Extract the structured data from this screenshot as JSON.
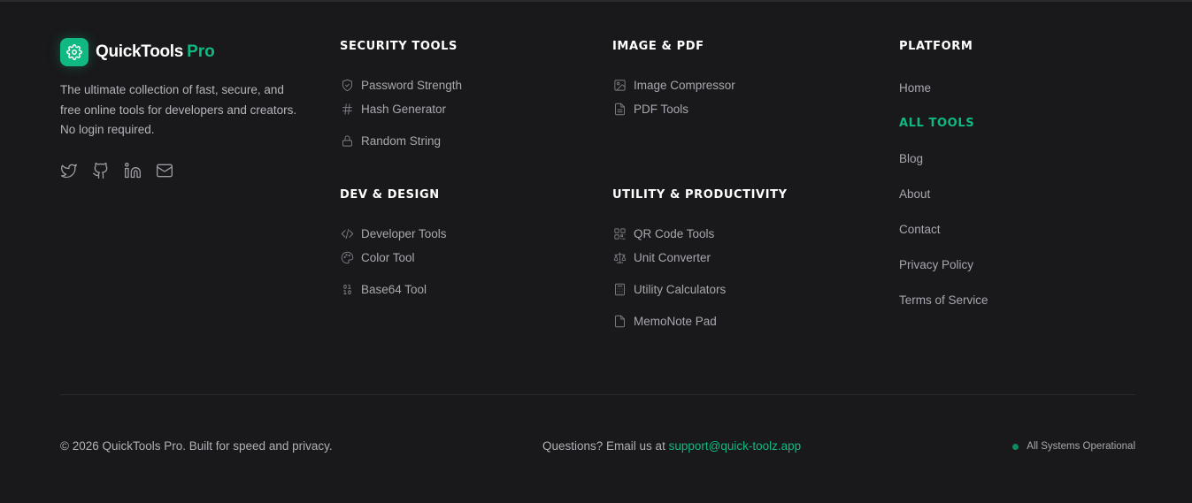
{
  "colors": {
    "accent": "#10b981",
    "background": "#19181a"
  },
  "brand": {
    "name": "QuickTools",
    "accent": "Pro",
    "logo_icon": "gear-icon",
    "description": "The ultimate collection of fast, secure, and free online tools for developers and creators. No login required.",
    "socials": [
      {
        "icon": "twitter-icon"
      },
      {
        "icon": "github-icon"
      },
      {
        "icon": "linkedin-icon"
      },
      {
        "icon": "mail-icon"
      }
    ]
  },
  "security": {
    "heading": "SECURITY TOOLS",
    "items": [
      {
        "label": "Password Strength",
        "icon": "shield-icon"
      },
      {
        "label": "Hash Generator",
        "icon": "hash-icon"
      },
      {
        "label": "Random String",
        "icon": "lock-icon"
      }
    ]
  },
  "dev": {
    "heading": "DEV & DESIGN",
    "items": [
      {
        "label": "Developer Tools",
        "icon": "code-icon"
      },
      {
        "label": "Color Tool",
        "icon": "palette-icon"
      },
      {
        "label": "Base64 Tool",
        "icon": "binary-icon"
      }
    ]
  },
  "image": {
    "heading": "IMAGE & PDF",
    "items": [
      {
        "label": "Image Compressor",
        "icon": "image-icon"
      },
      {
        "label": "PDF Tools",
        "icon": "file-text-icon"
      }
    ]
  },
  "utility": {
    "heading": "UTILITY & PRODUCTIVITY",
    "items": [
      {
        "label": "QR Code Tools",
        "icon": "qr-code-icon"
      },
      {
        "label": "Unit Converter",
        "icon": "scale-icon"
      },
      {
        "label": "Utility Calculators",
        "icon": "calculator-icon"
      },
      {
        "label": "MemoNote Pad",
        "icon": "file-icon"
      }
    ]
  },
  "platform": {
    "heading": "PLATFORM",
    "items": [
      "Home",
      "ALL TOOLS",
      "Blog",
      "About",
      "Contact",
      "Privacy Policy",
      "Terms of Service"
    ]
  },
  "bottom": {
    "copyright": "© 2026 QuickTools Pro. Built for speed and privacy.",
    "questions": "Questions? Email us at",
    "email": "support@quick-toolz.app",
    "status": "All Systems Operational"
  }
}
